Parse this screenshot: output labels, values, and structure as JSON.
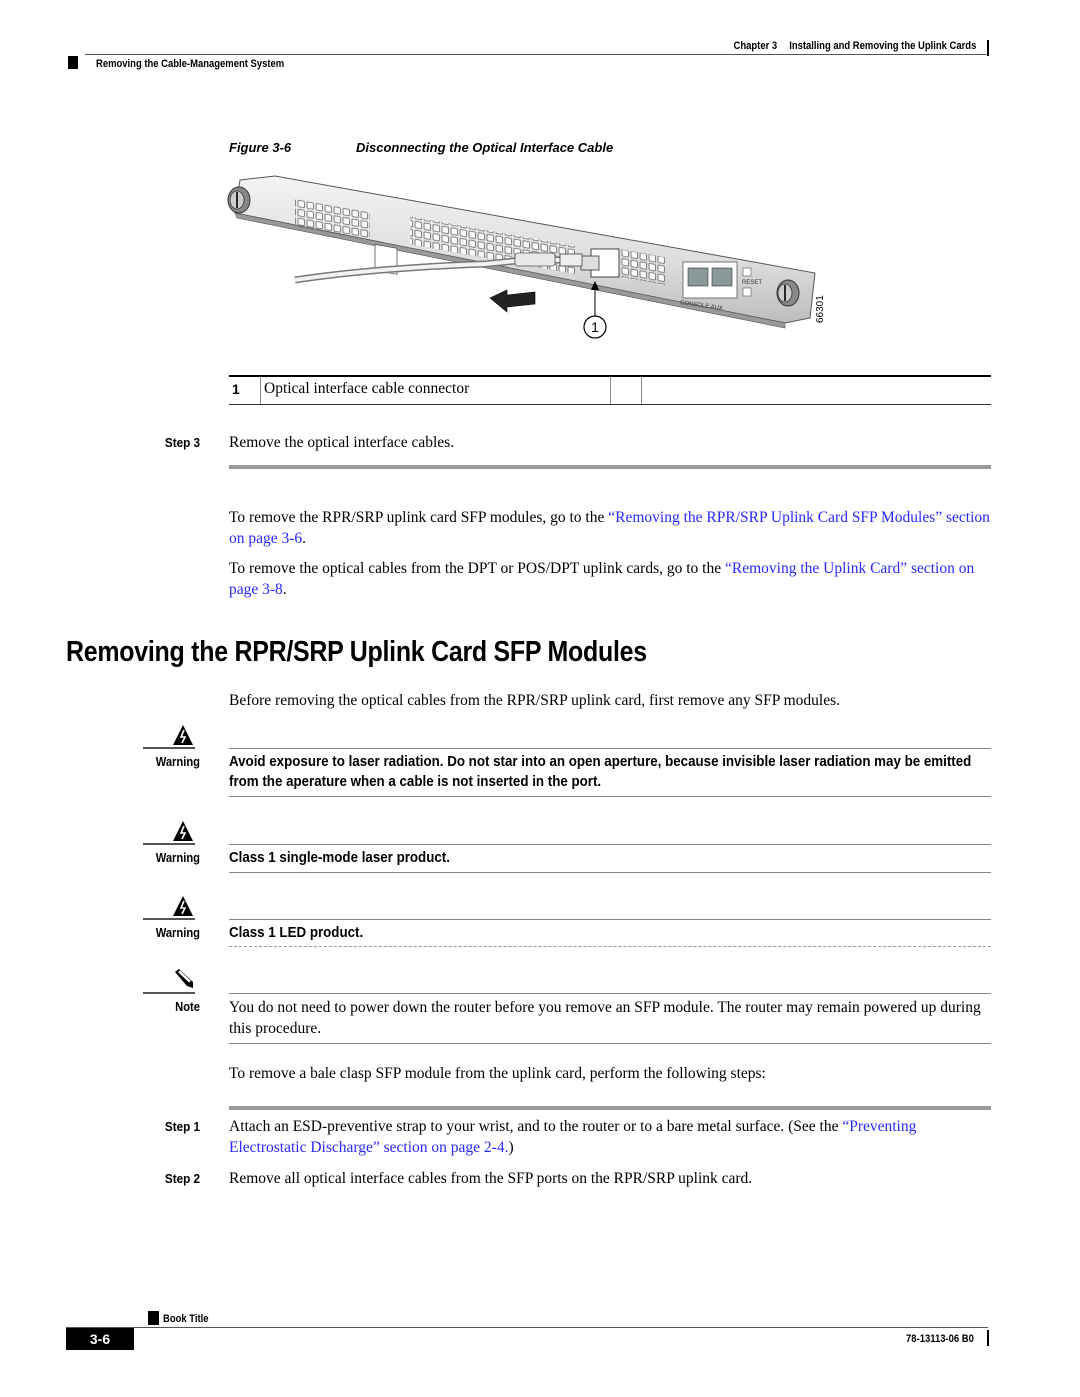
{
  "header": {
    "chapter": "Chapter 3",
    "chapter_title": "Installing and Removing the Uplink Cards",
    "section": "Removing the Cable-Management System"
  },
  "figure": {
    "label": "Figure 3-6",
    "title": "Disconnecting the Optical Interface Cable",
    "callout": "1",
    "art_id": "66301",
    "port_labels": {
      "console": "CONSOLE",
      "aux": "AUX",
      "reset": "RESET"
    }
  },
  "legend_table": {
    "rows": [
      {
        "num": "1",
        "text": "Optical interface cable connector"
      }
    ]
  },
  "step3": {
    "label": "Step 3",
    "text": "Remove the optical interface cables."
  },
  "para1": {
    "before": "To remove the RPR/SRP uplink card SFP modules, go to the ",
    "link": "“Removing the RPR/SRP Uplink Card SFP Modules” section on page 3-6",
    "after": "."
  },
  "para2": {
    "before": "To remove the optical cables from the DPT or POS/DPT uplink cards, go to the ",
    "link": "“Removing the Uplink Card” section on page 3-8",
    "after": "."
  },
  "section_heading": "Removing the RPR/SRP Uplink Card SFP Modules",
  "intro": "Before removing the optical cables from the RPR/SRP uplink card, first remove any SFP modules.",
  "warnings": [
    {
      "label": "Warning",
      "text": "Avoid exposure to laser radiation. Do not star into an open aperture, because invisible laser radiation may be emitted from the aperature when a cable is not inserted in the port."
    },
    {
      "label": "Warning",
      "text": "Class 1 single-mode laser product."
    },
    {
      "label": "Warning",
      "text": "Class 1 LED product."
    }
  ],
  "note": {
    "label": "Note",
    "text": "You do not need to power down the router before you remove an SFP module. The router may remain powered up during this procedure."
  },
  "procedure_intro": "To remove a bale clasp SFP module from the uplink card, perform the following steps:",
  "steps": [
    {
      "label": "Step 1",
      "text": "Attach an ESD-preventive strap to your wrist, and to the router or to a bare metal surface. (See the ",
      "link": "“Preventing Electrostatic Discharge” section on page 2-4.",
      "after": ")"
    },
    {
      "label": "Step 2",
      "text": "Remove all optical interface cables from the SFP ports on the RPR/SRP uplink card."
    }
  ],
  "footer": {
    "book_title": "Book Title",
    "page": "3-6",
    "doc_number": "78-13113-06 B0"
  },
  "colors": {
    "link": "#2a2aff",
    "rule": "#9a9a9a"
  }
}
